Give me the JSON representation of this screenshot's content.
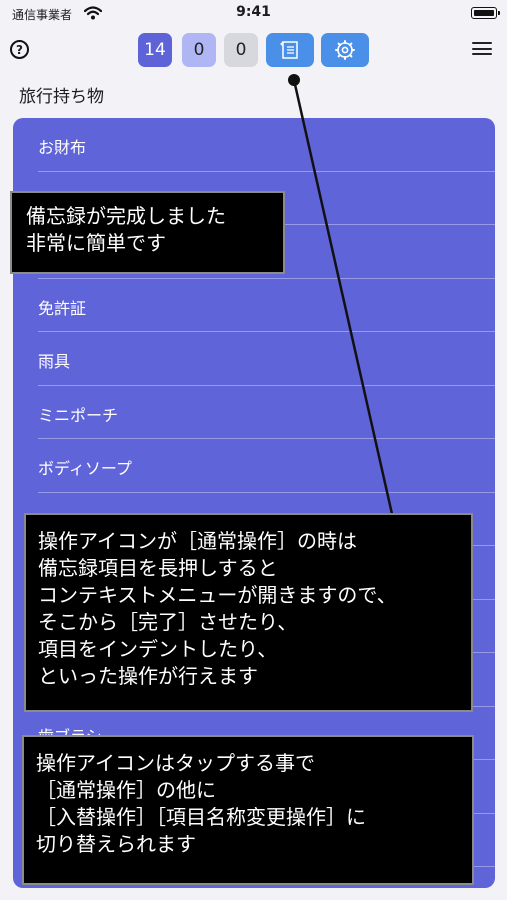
{
  "status_bar": {
    "carrier": "通信事業者",
    "time": "9:41"
  },
  "toolbar": {
    "help_glyph": "?",
    "counter_total": "14",
    "counter_done": "0",
    "counter_indent": "0",
    "memo_icon": "memo-list-icon",
    "settings_icon": "gear-icon",
    "menu_icon": "hamburger-menu-icon"
  },
  "list": {
    "title": "旅行持ち物",
    "items": [
      {
        "label": "お財布"
      },
      {
        "label": ""
      },
      {
        "label": ""
      },
      {
        "label": "免許証"
      },
      {
        "label": "雨具"
      },
      {
        "label": "ミニポーチ"
      },
      {
        "label": "ボディソープ"
      },
      {
        "label": ""
      },
      {
        "label": ""
      },
      {
        "label": ""
      },
      {
        "label": ""
      },
      {
        "label": "歯ブラシ"
      },
      {
        "label": ""
      },
      {
        "label": ""
      }
    ]
  },
  "callouts": {
    "one": [
      "備忘録が完成しました",
      "非常に簡単です"
    ],
    "two": [
      "操作アイコンが［通常操作］の時は",
      "備忘録項目を長押しすると",
      "コンテキストメニューが開きますので、",
      "そこから［完了］させたり、",
      "項目をインデントしたり、",
      "といった操作が行えます"
    ],
    "three": [
      "操作アイコンはタップする事で",
      "［通常操作］の他に",
      "［入替操作］［項目名称変更操作］に",
      "切り替えられます"
    ]
  },
  "colors": {
    "background": "#f2f2f7",
    "list_card": "#6064d9",
    "counter_total": "#5e63d8",
    "counter_done": "#b0b6f4",
    "counter_indent": "#d7d7de",
    "tool_button": "#4a90e8",
    "callout_bg": "#000000"
  }
}
